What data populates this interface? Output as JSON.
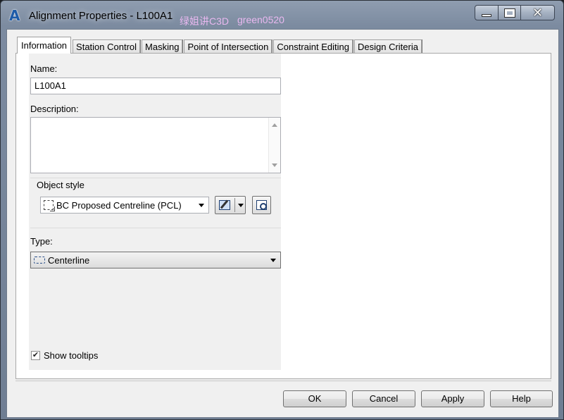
{
  "window": {
    "title": "Alignment Properties - L100A1",
    "watermark_text": "绿姐讲C3D",
    "watermark_id": "green0520",
    "controls": {
      "minimize": "minimize",
      "maximize": "maximize",
      "close": "✕"
    }
  },
  "tabs": [
    {
      "label": "Information",
      "active": true
    },
    {
      "label": "Station Control"
    },
    {
      "label": "Masking"
    },
    {
      "label": "Point of Intersection"
    },
    {
      "label": "Constraint Editing"
    },
    {
      "label": "Design Criteria"
    }
  ],
  "form": {
    "name_label": "Name:",
    "name_value": "L100A1",
    "description_label": "Description:",
    "description_value": "",
    "object_style_label": "Object style",
    "object_style_value": "BC Proposed Centreline (PCL)",
    "type_label": "Type:",
    "type_value": "Centerline",
    "show_tooltips_label": "Show tooltips",
    "show_tooltips_checked": true,
    "check_glyph": "✔"
  },
  "buttons": {
    "ok": "OK",
    "cancel": "Cancel",
    "apply": "Apply",
    "help": "Help"
  }
}
